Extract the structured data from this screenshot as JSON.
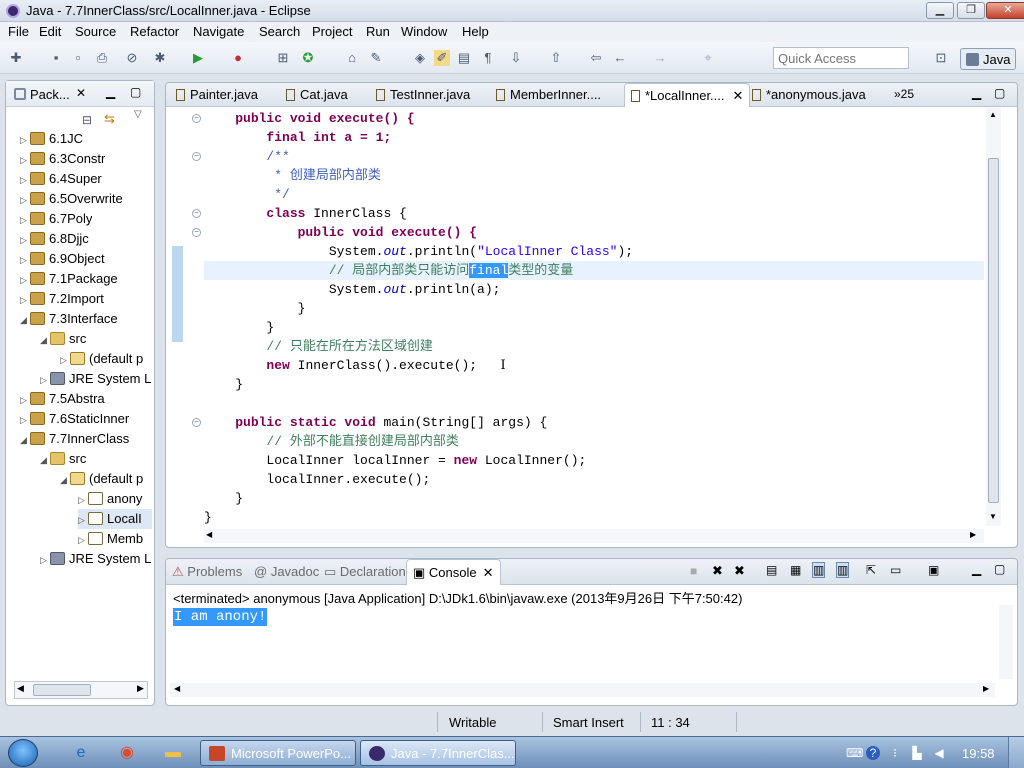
{
  "window": {
    "title": "Java - 7.7InnerClass/src/LocalInner.java - Eclipse",
    "min_label": "▁",
    "max_label": "❐",
    "close_label": "✕"
  },
  "menu": [
    "File",
    "Edit",
    "Source",
    "Refactor",
    "Navigate",
    "Search",
    "Project",
    "Run",
    "Window",
    "Help"
  ],
  "toolbar": {
    "quick_access_placeholder": "Quick Access",
    "perspective_label": "Java"
  },
  "package_explorer": {
    "tab_label": "Pack...",
    "items": [
      {
        "label": "6.1JC",
        "twisty": "▷"
      },
      {
        "label": "6.3Constr",
        "twisty": "▷"
      },
      {
        "label": "6.4Super",
        "twisty": "▷"
      },
      {
        "label": "6.5Overwrite",
        "twisty": "▷"
      },
      {
        "label": "6.7Poly",
        "twisty": "▷"
      },
      {
        "label": "6.8Djjc",
        "twisty": "▷"
      },
      {
        "label": "6.9Object",
        "twisty": "▷"
      },
      {
        "label": "7.1Package",
        "twisty": "▷"
      },
      {
        "label": "7.2Import",
        "twisty": "▷"
      },
      {
        "label": "7.3Interface",
        "twisty": "◢"
      },
      {
        "label": "src",
        "twisty": "◢"
      },
      {
        "label": "(default p",
        "twisty": "▷"
      },
      {
        "label": "JRE System L",
        "twisty": "▷"
      },
      {
        "label": "7.5Abstra",
        "twisty": "▷"
      },
      {
        "label": "7.6StaticInner",
        "twisty": "▷"
      },
      {
        "label": "7.7InnerClass",
        "twisty": "◢"
      },
      {
        "label": "src",
        "twisty": "◢"
      },
      {
        "label": "(default p",
        "twisty": "◢"
      },
      {
        "label": "anony",
        "twisty": "▷"
      },
      {
        "label": "LocalI",
        "twisty": "▷"
      },
      {
        "label": "Memb",
        "twisty": "▷"
      },
      {
        "label": "JRE System L",
        "twisty": "▷"
      }
    ]
  },
  "editor": {
    "tabs": [
      "Painter.java",
      "Cat.java",
      "TestInner.java",
      "MemberInner....",
      "*LocalInner....",
      "*anonymous.java"
    ],
    "overflow_label": "»25",
    "code": {
      "l1": "public void execute() {",
      "l2": "final int a = 1;",
      "l3": "/**",
      "l4": " * 创建局部内部类",
      "l5": " */",
      "l6a": "class ",
      "l6b": "InnerClass {",
      "l7": "public void execute() {",
      "l8a": "System.",
      "l8b": "out",
      "l8c": ".println(",
      "l8d": "\"LocalInner Class\"",
      "l8e": ");",
      "l9a": "// 局部内部类只能访问",
      "l9b": "final",
      "l9c": "类型的变量",
      "l10a": "System.",
      "l10b": "out",
      "l10c": ".println(a);",
      "l11": "}",
      "l12": "}",
      "l13": "// 只能在所在方法区域创建",
      "l14a": "new ",
      "l14b": "InnerClass().execute();",
      "l15": "}",
      "l17a": "public static void ",
      "l17b": "main(String[] args) {",
      "l18": "// 外部不能直接创建局部内部类",
      "l19a": "LocalInner localInner = ",
      "l19b": "new ",
      "l19c": "LocalInner();",
      "l20": "localInner.execute();",
      "l21": "}",
      "l22": "}"
    }
  },
  "console": {
    "tabs": [
      "Problems",
      "Javadoc",
      "Declaration",
      "Console"
    ],
    "status_line": "<terminated> anonymous [Java Application] D:\\JDk1.6\\bin\\javaw.exe (2013年9月26日 下午7:50:42)",
    "output": "I am anony!"
  },
  "statusbar": {
    "writable": "Writable",
    "insert_mode": "Smart Insert",
    "position": "11 : 34"
  },
  "taskbar": {
    "tasks": [
      "Microsoft PowerPo...",
      "Java - 7.7InnerClas..."
    ],
    "clock": "19:58"
  },
  "colors": {
    "keyword": "#7f0055",
    "comment": "#3f7f5f",
    "javadoc": "#3f5fbf",
    "string": "#2a00ff",
    "selection": "#3399ff"
  }
}
